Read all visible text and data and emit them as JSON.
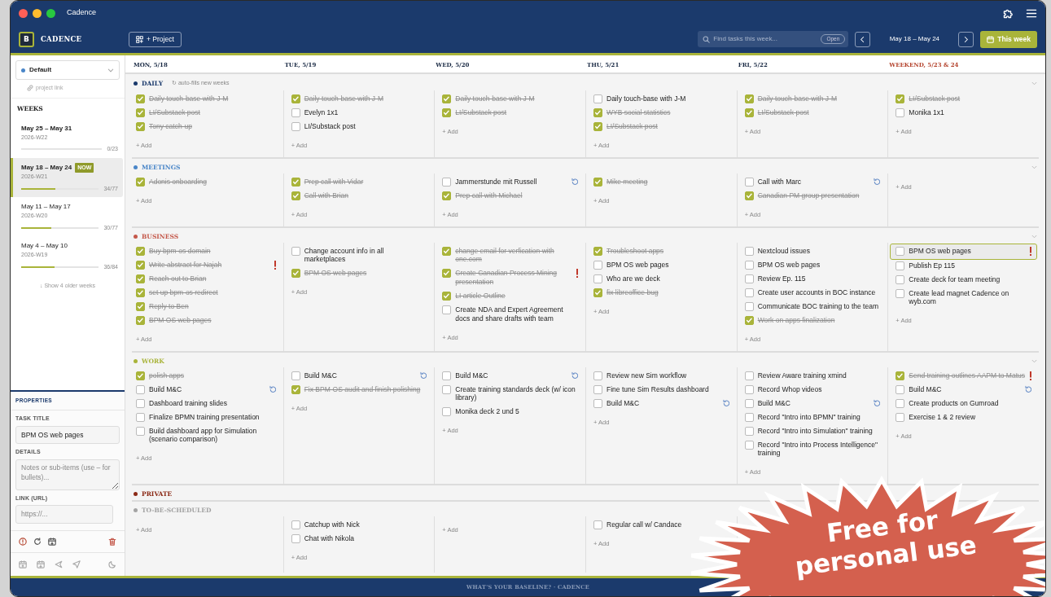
{
  "window": {
    "title": "Cadence"
  },
  "header": {
    "logo_letter": "B",
    "app_name": "CADENCE",
    "new_project": "+ Project",
    "search": {
      "placeholder": "Find tasks this week..."
    },
    "open_button": "Open",
    "week_range": "May 18 – May 24",
    "this_week": "This week"
  },
  "sidebar": {
    "project": "Default",
    "project_link": "project link",
    "weeks_title": "WEEKS",
    "weeks": [
      {
        "range": "May 25 – May 31",
        "code": "2026-W22",
        "count": "0/23",
        "level": 0,
        "selected": false
      },
      {
        "range": "May 18 – May 24",
        "badge": "NOW",
        "code": "2026-W21",
        "count": "34/77",
        "level": 0.44,
        "selected": true
      },
      {
        "range": "May 11 – May 17",
        "code": "2026-W20",
        "count": "30/77",
        "level": 0.39,
        "selected": false
      },
      {
        "range": "May 4 – May 10",
        "code": "2026-W19",
        "count": "36/84",
        "level": 0.43,
        "selected": false
      }
    ],
    "show_older": "↓ Show 4 older weeks"
  },
  "properties": {
    "title": "PROPERTIES",
    "task_title_label": "TASK TITLE",
    "task_title": "BPM OS web pages",
    "details_label": "DETAILS",
    "details_placeholder": "Notes or sub-items (use – for bullets)...",
    "link_label": "LINK (URL)",
    "link_placeholder": "https://..."
  },
  "days": [
    {
      "label": "MON, 5/18",
      "weekend": false
    },
    {
      "label": "TUE, 5/19",
      "weekend": false
    },
    {
      "label": "WED, 5/20",
      "weekend": false
    },
    {
      "label": "THU, 5/21",
      "weekend": false
    },
    {
      "label": "FRI, 5/22",
      "weekend": false
    },
    {
      "label": "WEEKEND, 5/23 & 24",
      "weekend": true
    }
  ],
  "sections": [
    {
      "title": "DAILY",
      "color": "#1b3a6c",
      "note": "↻ auto-fills new weeks",
      "chevron": true,
      "cells": [
        {
          "add": "+ Add",
          "tasks": [
            {
              "text": "Daily touch-base with J-M",
              "done": true,
              "repeat": false,
              "urgent": false,
              "selected": false
            },
            {
              "text": "LI/Substack post",
              "done": true,
              "repeat": false,
              "urgent": false,
              "selected": false
            },
            {
              "text": "Tony catch-up",
              "done": true,
              "repeat": false,
              "urgent": false,
              "selected": false
            }
          ]
        },
        {
          "add": "+ Add",
          "tasks": [
            {
              "text": "Daily touch-base with J-M",
              "done": true,
              "repeat": false,
              "urgent": false,
              "selected": false
            },
            {
              "text": "Evelyn 1x1",
              "done": false,
              "repeat": false,
              "urgent": false,
              "selected": false
            },
            {
              "text": "LI/Substack post",
              "done": false,
              "repeat": false,
              "urgent": false,
              "selected": false
            }
          ]
        },
        {
          "add": "+ Add",
          "tasks": [
            {
              "text": "Daily touch-base with J-M",
              "done": true,
              "repeat": false,
              "urgent": false,
              "selected": false
            },
            {
              "text": "LI/Substack post",
              "done": true,
              "repeat": false,
              "urgent": false,
              "selected": false
            }
          ]
        },
        {
          "add": "+ Add",
          "tasks": [
            {
              "text": "Daily touch-base with J-M",
              "done": false,
              "repeat": false,
              "urgent": false,
              "selected": false
            },
            {
              "text": "WYB social statistics",
              "done": true,
              "repeat": false,
              "urgent": false,
              "selected": false
            },
            {
              "text": "LI/Substack post",
              "done": true,
              "repeat": false,
              "urgent": false,
              "selected": false
            }
          ]
        },
        {
          "add": "+ Add",
          "tasks": [
            {
              "text": "Daily touch-base with J-M",
              "done": true,
              "repeat": false,
              "urgent": false,
              "selected": false
            },
            {
              "text": "LI/Substack post",
              "done": true,
              "repeat": false,
              "urgent": false,
              "selected": false
            }
          ]
        },
        {
          "add": "+ Add",
          "tasks": [
            {
              "text": "LI/Substack post",
              "done": true,
              "repeat": false,
              "urgent": false,
              "selected": false
            },
            {
              "text": "Monika 1x1",
              "done": false,
              "repeat": false,
              "urgent": false,
              "selected": false
            }
          ]
        }
      ]
    },
    {
      "title": "MEETINGS",
      "color": "#4a86c8",
      "chevron": true,
      "cells": [
        {
          "add": "+ Add",
          "tasks": [
            {
              "text": "Adonis onboarding",
              "done": true,
              "repeat": false,
              "urgent": false,
              "selected": false
            }
          ]
        },
        {
          "add": "+ Add",
          "tasks": [
            {
              "text": "Prep call with Vidar",
              "done": true,
              "repeat": false,
              "urgent": false,
              "selected": false
            },
            {
              "text": "Call with Brian",
              "done": true,
              "repeat": false,
              "urgent": false,
              "selected": false
            }
          ]
        },
        {
          "add": "+ Add",
          "tasks": [
            {
              "text": "Jammerstunde mit Russell",
              "done": false,
              "repeat": true,
              "urgent": false,
              "selected": false
            },
            {
              "text": "Prep call with Michael",
              "done": true,
              "repeat": false,
              "urgent": false,
              "selected": false
            }
          ]
        },
        {
          "add": "+ Add",
          "tasks": [
            {
              "text": "Mike meeting",
              "done": true,
              "repeat": false,
              "urgent": false,
              "selected": false
            }
          ]
        },
        {
          "add": "+ Add",
          "tasks": [
            {
              "text": "Call with Marc",
              "done": false,
              "repeat": true,
              "urgent": false,
              "selected": false
            },
            {
              "text": "Canadian PM group presentation",
              "done": true,
              "repeat": false,
              "urgent": false,
              "selected": false
            }
          ]
        },
        {
          "add": "+ Add"
        }
      ]
    },
    {
      "title": "BUSINESS",
      "color": "#c4584a",
      "chevron": true,
      "cells": [
        {
          "add": "+ Add",
          "tasks": [
            {
              "text": "Buy bpm-os domain",
              "done": true,
              "repeat": false,
              "urgent": false,
              "selected": false
            },
            {
              "text": "Write abstract for Najah",
              "done": true,
              "repeat": false,
              "urgent": true,
              "selected": false
            },
            {
              "text": "Reach out to Brian",
              "done": true,
              "repeat": false,
              "urgent": false,
              "selected": false
            },
            {
              "text": "set up bpm-os redirect",
              "done": true,
              "repeat": false,
              "urgent": false,
              "selected": false
            },
            {
              "text": "Reply to Ben",
              "done": true,
              "repeat": false,
              "urgent": false,
              "selected": false
            },
            {
              "text": "BPM OS web pages",
              "done": true,
              "repeat": false,
              "urgent": false,
              "selected": false
            }
          ]
        },
        {
          "add": "+ Add",
          "tasks": [
            {
              "text": "Change account info in all marketplaces",
              "done": false,
              "repeat": false,
              "urgent": false,
              "selected": false
            },
            {
              "text": "BPM OS web pages",
              "done": true,
              "repeat": false,
              "urgent": false,
              "selected": false
            }
          ]
        },
        {
          "add": "+ Add",
          "tasks": [
            {
              "text": "change email for verfication with one.com",
              "done": true,
              "repeat": false,
              "urgent": false,
              "selected": false
            },
            {
              "text": "Create Canadian Process Mining presentation",
              "done": true,
              "repeat": false,
              "urgent": true,
              "selected": false
            },
            {
              "text": "LI article Outline",
              "done": true,
              "repeat": false,
              "urgent": false,
              "selected": false
            },
            {
              "text": "Create NDA and Expert Agreement docs and share drafts with team",
              "done": false,
              "repeat": false,
              "urgent": false,
              "selected": false
            }
          ]
        },
        {
          "add": "+ Add",
          "tasks": [
            {
              "text": "Troubleshoot apps",
              "done": true,
              "repeat": false,
              "urgent": false,
              "selected": false
            },
            {
              "text": "BPM OS web pages",
              "done": false,
              "repeat": false,
              "urgent": false,
              "selected": false
            },
            {
              "text": "Who are we deck",
              "done": false,
              "repeat": false,
              "urgent": false,
              "selected": false
            },
            {
              "text": "fix libreoffice bug",
              "done": true,
              "repeat": false,
              "urgent": false,
              "selected": false
            }
          ]
        },
        {
          "add": "+ Add",
          "tasks": [
            {
              "text": "Nextcloud issues",
              "done": false,
              "repeat": false,
              "urgent": false,
              "selected": false
            },
            {
              "text": "BPM OS web pages",
              "done": false,
              "repeat": false,
              "urgent": false,
              "selected": false
            },
            {
              "text": "Review Ep. 115",
              "done": false,
              "repeat": false,
              "urgent": false,
              "selected": false
            },
            {
              "text": "Create user accounts in BOC instance",
              "done": false,
              "repeat": false,
              "urgent": false,
              "selected": false
            },
            {
              "text": "Communicate BOC training to the team",
              "done": false,
              "repeat": false,
              "urgent": false,
              "selected": false
            },
            {
              "text": "Work on apps finalization",
              "done": true,
              "repeat": false,
              "urgent": false,
              "selected": false
            }
          ]
        },
        {
          "add": "+ Add",
          "tasks": [
            {
              "text": "BPM OS web pages",
              "done": false,
              "repeat": false,
              "urgent": true,
              "selected": true
            },
            {
              "text": "Publish Ep 115",
              "done": false,
              "repeat": false,
              "urgent": false,
              "selected": false
            },
            {
              "text": "Create deck for team meeting",
              "done": false,
              "repeat": false,
              "urgent": false,
              "selected": false
            },
            {
              "text": "Create lead magnet Cadence on wyb.com",
              "done": false,
              "repeat": false,
              "urgent": false,
              "selected": false
            }
          ]
        }
      ]
    },
    {
      "title": "WORK",
      "color": "#a9b43a",
      "chevron": true,
      "cells": [
        {
          "add": "+ Add",
          "tasks": [
            {
              "text": "polish apps",
              "done": true,
              "repeat": false,
              "urgent": false,
              "selected": false
            },
            {
              "text": "Build M&C",
              "done": false,
              "repeat": true,
              "urgent": false,
              "selected": false
            },
            {
              "text": "Dashboard training slides",
              "done": false,
              "repeat": false,
              "urgent": false,
              "selected": false
            },
            {
              "text": "Finalize BPMN training presentation",
              "done": false,
              "repeat": false,
              "urgent": false,
              "selected": false
            },
            {
              "text": "Build dashboard app for Simulation (scenario comparison)",
              "done": false,
              "repeat": false,
              "urgent": false,
              "selected": false
            }
          ]
        },
        {
          "add": "+ Add",
          "tasks": [
            {
              "text": "Build M&C",
              "done": false,
              "repeat": true,
              "urgent": false,
              "selected": false
            },
            {
              "text": "Fix BPM-OS audit and finish polishing",
              "done": true,
              "repeat": false,
              "urgent": false,
              "selected": false
            }
          ]
        },
        {
          "add": "+ Add",
          "tasks": [
            {
              "text": "Build M&C",
              "done": false,
              "repeat": true,
              "urgent": false,
              "selected": false
            },
            {
              "text": "Create training standards deck (w/ icon library)",
              "done": false,
              "repeat": false,
              "urgent": false,
              "selected": false
            },
            {
              "text": "Monika deck 2 und 5",
              "done": false,
              "repeat": false,
              "urgent": false,
              "selected": false
            }
          ]
        },
        {
          "add": "+ Add",
          "tasks": [
            {
              "text": "Review new Sim workflow",
              "done": false,
              "repeat": false,
              "urgent": false,
              "selected": false
            },
            {
              "text": "Fine tune Sim Results dashboard",
              "done": false,
              "repeat": false,
              "urgent": false,
              "selected": false
            },
            {
              "text": "Build M&C",
              "done": false,
              "repeat": true,
              "urgent": false,
              "selected": false
            }
          ]
        },
        {
          "add": "+ Add",
          "tasks": [
            {
              "text": "Review Aware training xmind",
              "done": false,
              "repeat": false,
              "urgent": false,
              "selected": false
            },
            {
              "text": "Record Whop videos",
              "done": false,
              "repeat": false,
              "urgent": false,
              "selected": false
            },
            {
              "text": "Build M&C",
              "done": false,
              "repeat": true,
              "urgent": false,
              "selected": false
            },
            {
              "text": "Record \"Intro into BPMN\" training",
              "done": false,
              "repeat": false,
              "urgent": false,
              "selected": false
            },
            {
              "text": "Record \"Intro into Simulation\" training",
              "done": false,
              "repeat": false,
              "urgent": false,
              "selected": false
            },
            {
              "text": "Record \"Intro into Process Intelligence\" training",
              "done": false,
              "repeat": false,
              "urgent": false,
              "selected": false
            }
          ]
        },
        {
          "add": "+ Add",
          "tasks": [
            {
              "text": "Send training outlines AAPM to Matus",
              "done": true,
              "repeat": false,
              "urgent": true,
              "selected": false
            },
            {
              "text": "Build M&C",
              "done": false,
              "repeat": true,
              "urgent": false,
              "selected": false
            },
            {
              "text": "Create products on Gumroad",
              "done": false,
              "repeat": false,
              "urgent": false,
              "selected": false
            },
            {
              "text": "Exercise 1 & 2 review",
              "done": false,
              "repeat": false,
              "urgent": false,
              "selected": false
            }
          ]
        }
      ]
    },
    {
      "title": "PRIVATE",
      "color": "#8b2a16",
      "chevron": false
    },
    {
      "title": "TO-BE-SCHEDULED",
      "color": "#a3a3a3",
      "chevron": false,
      "cells": [
        {
          "add": "+ Add"
        },
        {
          "add": "+ Add",
          "tasks": [
            {
              "text": "Catchup with Nick",
              "done": false,
              "repeat": false,
              "urgent": false,
              "selected": false
            },
            {
              "text": "Chat with Nikola",
              "done": false,
              "repeat": false,
              "urgent": false,
              "selected": false
            }
          ]
        },
        {
          "add": "+ Add"
        },
        {
          "add": "+ Add",
          "tasks": [
            {
              "text": "Regular call w/ Candace",
              "done": false,
              "repeat": false,
              "urgent": false,
              "selected": false
            }
          ]
        },
        {},
        {}
      ]
    }
  ],
  "footer": "WHAT'S YOUR BASELINE? · CADENCE",
  "promo": "Free for personal use"
}
